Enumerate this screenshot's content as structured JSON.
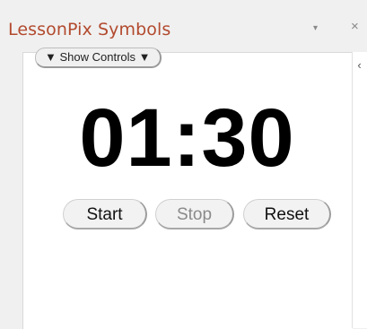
{
  "pane": {
    "title": "LessonPix Symbols",
    "menu_glyph": "▾",
    "close_glyph": "×",
    "collapse_glyph": "‹"
  },
  "controls": {
    "show_label": "▼ Show Controls ▼"
  },
  "timer": {
    "display": "01:30"
  },
  "buttons": {
    "start": "Start",
    "stop": "Stop",
    "reset": "Reset",
    "stop_disabled": true
  },
  "colors": {
    "title": "#b24a2e",
    "background": "#f0f0f0",
    "content": "#ffffff",
    "disabled_text": "#8a8a8a"
  }
}
